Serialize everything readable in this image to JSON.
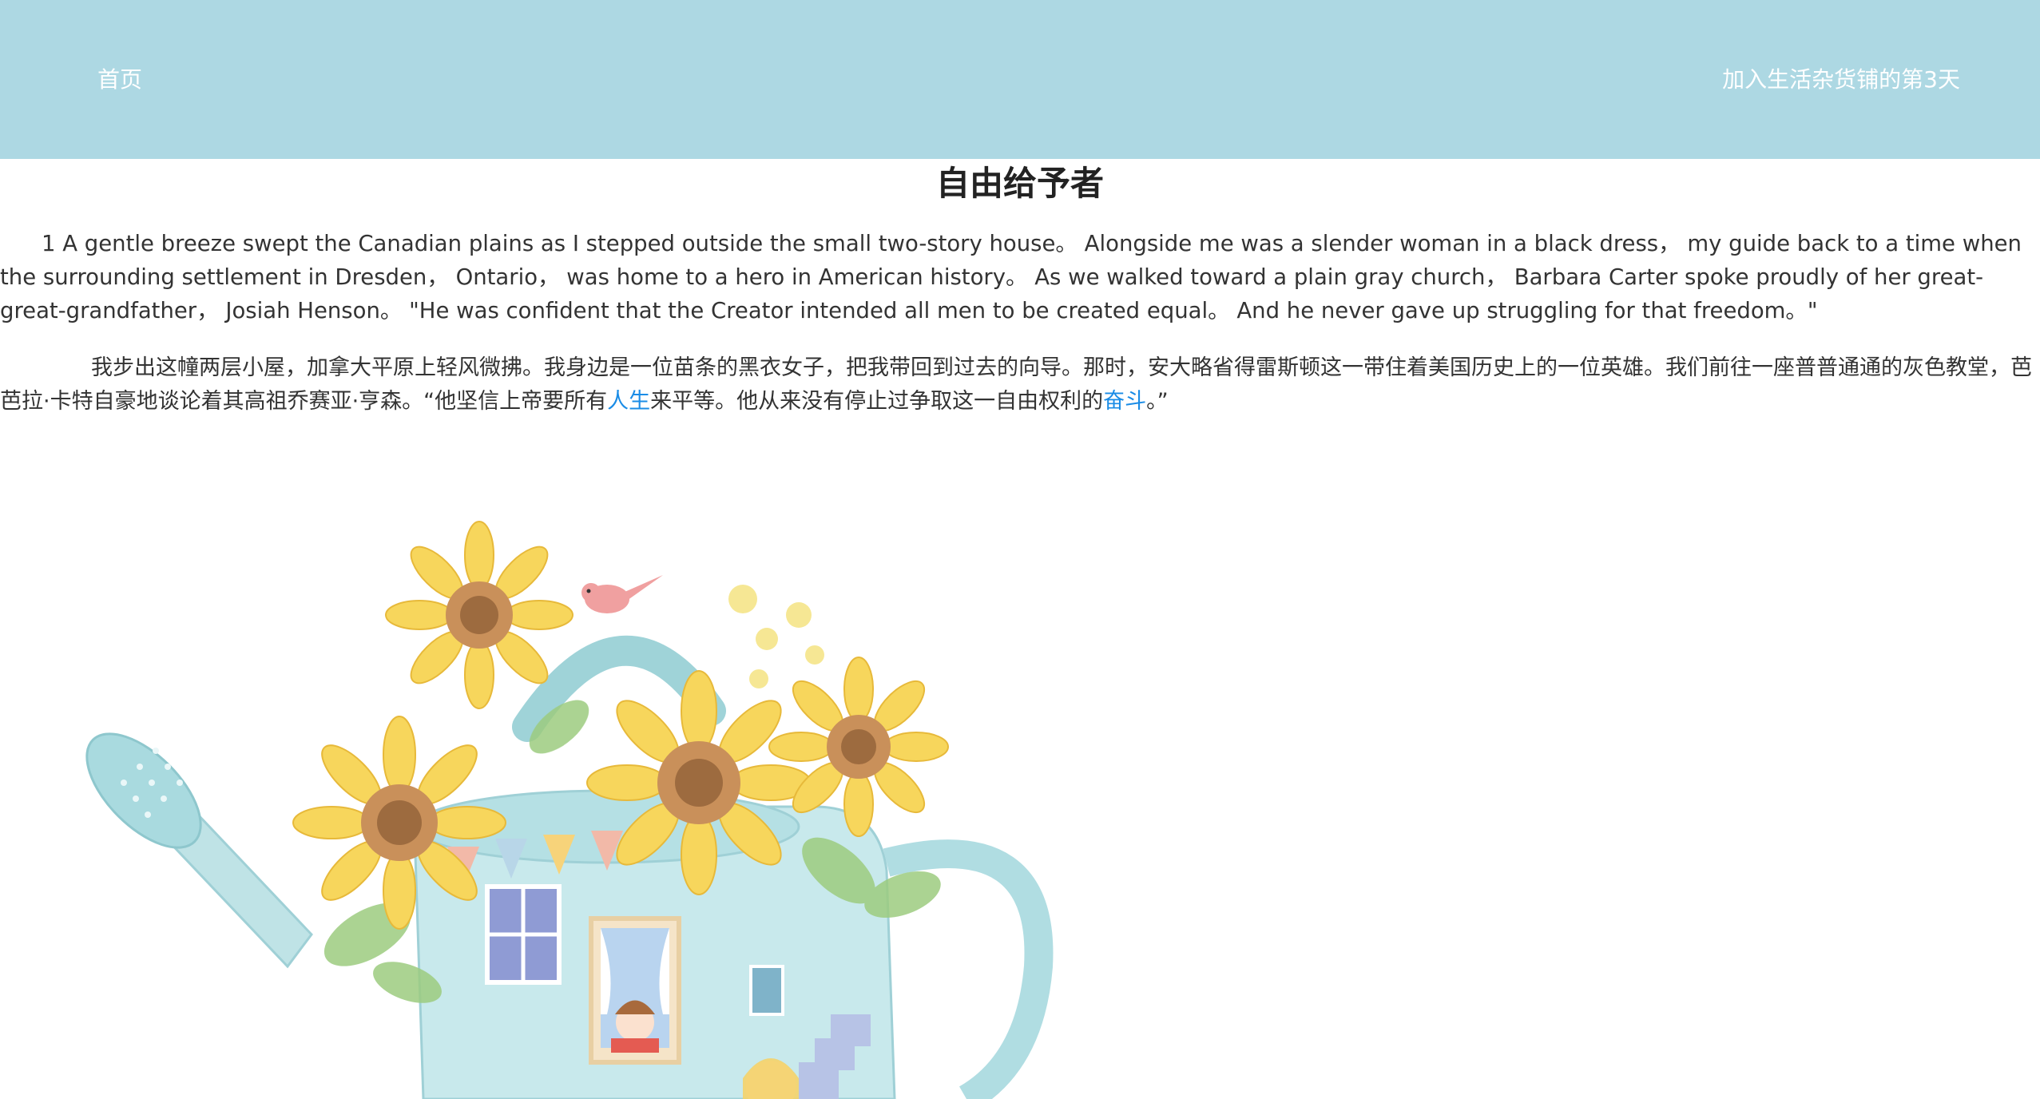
{
  "nav": {
    "home_label": "首页",
    "day_label": "加入生活杂货铺的第3天"
  },
  "article": {
    "title": "自由给予者",
    "en_paragraph": "1 A gentle breeze swept the Canadian plains as I stepped outside the small two-story house。 Alongside me was a slender woman in a black dress， my guide back to a time when the surrounding settlement in Dresden， Ontario， was home to a hero in American history。 As we walked toward a plain gray church， Barbara Carter spoke proudly of her great-great-grandfather， Josiah Henson。 \"He was confident that the Creator intended all men to be created equal。 And he never gave up struggling for that freedom。\"",
    "zh_part1": "我步出这幢两层小屋，加拿大平原上轻风微拂。我身边是一位苗条的黑衣女子，把我带回到过去的向导。那时，安大略省得雷斯顿这一带住着美国历史上的一位英雄。我们前往一座普普通通的灰色教堂，芭芭拉·卡特自豪地谈论着其高祖乔赛亚·亨森。“他坚信上帝要所有",
    "zh_link1": "人生",
    "zh_part2": "来平等。他从来没有停止过争取这一自由权利的",
    "zh_link2": "奋斗",
    "zh_part3": "。”"
  },
  "colors": {
    "header_bg": "#add8e3",
    "link": "#1a8ce6"
  },
  "image": {
    "description_icon": "sunflower-watering-can-illustration"
  }
}
